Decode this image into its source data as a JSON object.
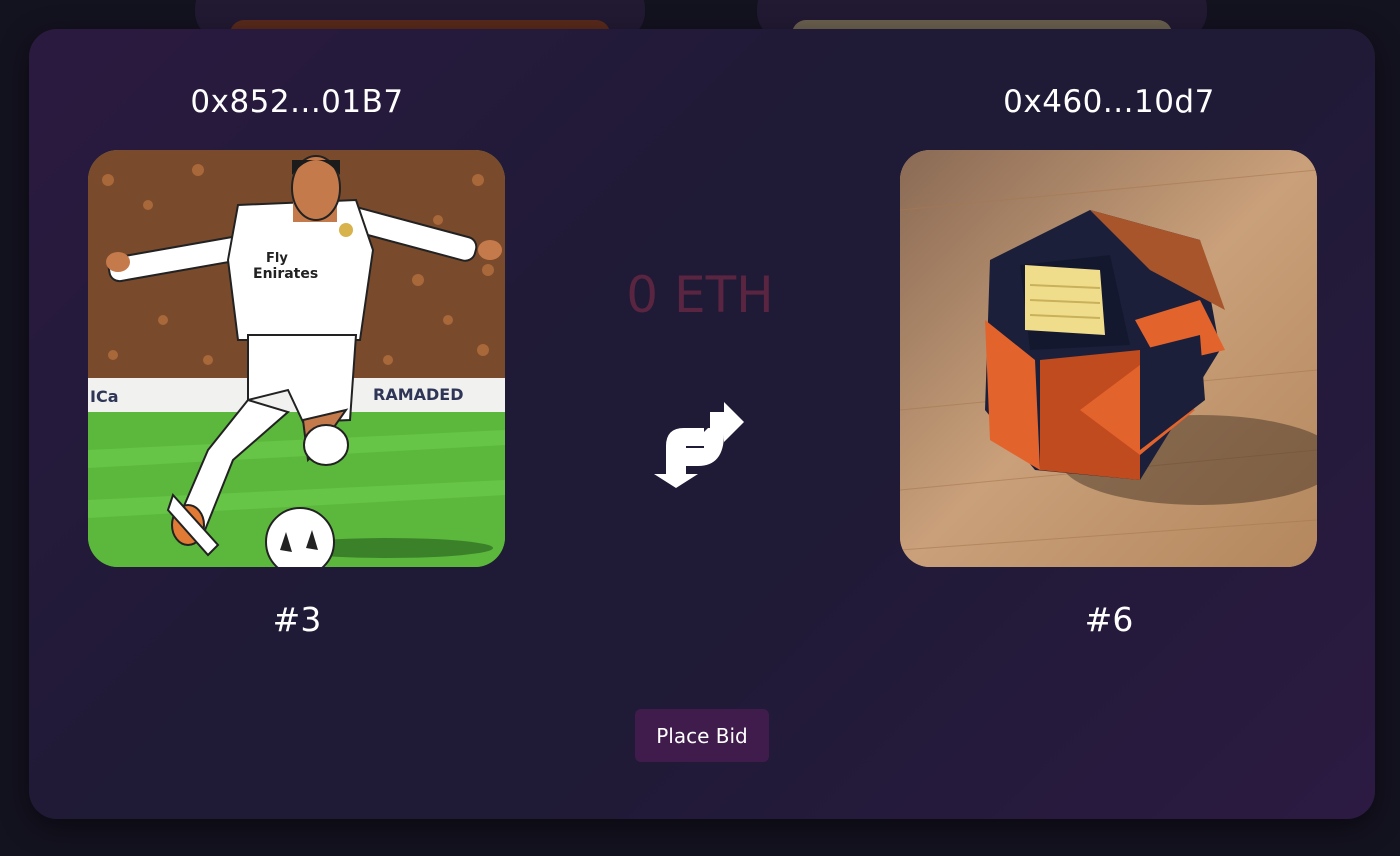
{
  "trade": {
    "left": {
      "owner_address": "0x852...01B7",
      "token_id": "#3",
      "image": "soccer-player-nft-image"
    },
    "right": {
      "owner_address": "0x460...10d7",
      "token_id": "#6",
      "image": "puzzle-cube-nft-image"
    },
    "price": "0 ETH",
    "swap_icon": "swap-arrows-icon",
    "place_bid_label": "Place Bid"
  },
  "colors": {
    "page_background": "#13121f",
    "modal_background": "#1f1a36",
    "price_text": "#5a2540",
    "button_background": "#401c4d"
  }
}
